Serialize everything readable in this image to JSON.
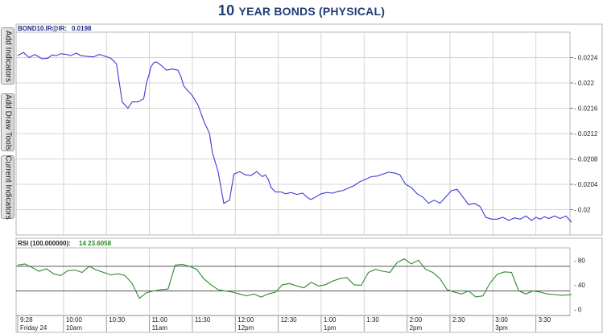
{
  "title": {
    "main": "10",
    "rest": "YEAR BONDS (PHYSICAL)"
  },
  "side_tabs": [
    "Add Indicators",
    "Add Draw Tools",
    "Current Indicators"
  ],
  "price_panel": {
    "symbol_label": "BOND10.IR@IR:",
    "last_value": "0.0198"
  },
  "rsi_panel": {
    "label": "RSI (100.000000):",
    "values": "14 23.6058"
  },
  "colors": {
    "title": "#1f3e78",
    "price_line": "#3b3bd6",
    "rsi_line": "#2a8a2a",
    "grid": "#d4d4d4",
    "band": "#555555",
    "rsi_value": "#1e8a1e",
    "label": "#1a2a8a"
  },
  "chart_data": [
    {
      "type": "line",
      "title": "",
      "ylim": [
        0.0196,
        0.0228
      ],
      "y_ticks": [
        0.02,
        0.0204,
        0.0208,
        0.0212,
        0.0216,
        0.022,
        0.0224
      ],
      "y_tick_labels": [
        "0.02",
        "0.0204",
        "0.0208",
        "0.0212",
        "0.0216",
        "0.022",
        "0.0224"
      ],
      "x_ticks": [
        "9:28",
        "10:00",
        "10:30",
        "11:00",
        "11:30",
        "12:00",
        "12:30",
        "1:00",
        "1:30",
        "2:00",
        "2:30",
        "3:00",
        "3:30"
      ],
      "x_sublabels": [
        "Friday 24",
        "10am",
        "",
        "11am",
        "",
        "12pm",
        "",
        "1pm",
        "",
        "2pm",
        "",
        "3pm",
        ""
      ],
      "x_unit": "minutes after 9:28",
      "series": [
        {
          "x": [
            0,
            4,
            8,
            12,
            14,
            17,
            21,
            24,
            27,
            30,
            34,
            37,
            41,
            44,
            48,
            53,
            57,
            61,
            65,
            69,
            73,
            77,
            80,
            84,
            88,
            90,
            92,
            93,
            95,
            97,
            100,
            104,
            108,
            112,
            114,
            116,
            118,
            122,
            126,
            130,
            134,
            136,
            140,
            144,
            148,
            151,
            155,
            159,
            163,
            167,
            171,
            173,
            175,
            177,
            180,
            184,
            187,
            191,
            195,
            199,
            203,
            205,
            208,
            212,
            216,
            220,
            224,
            227,
            231,
            235,
            239,
            243,
            247,
            251,
            255,
            259,
            263,
            267,
            271,
            275,
            279,
            283,
            287,
            291,
            295,
            299,
            303,
            307,
            311,
            315,
            319,
            323,
            327,
            331,
            335,
            339,
            343,
            347,
            351,
            355,
            359,
            362,
            365,
            368,
            371,
            375,
            379,
            383,
            387
          ],
          "y": [
            0.02243,
            0.02248,
            0.0224,
            0.02245,
            0.02242,
            0.02238,
            0.02239,
            0.02244,
            0.02243,
            0.02246,
            0.02245,
            0.02243,
            0.02247,
            0.02243,
            0.02242,
            0.02241,
            0.02245,
            0.02242,
            0.02239,
            0.0223,
            0.0217,
            0.0216,
            0.0217,
            0.0217,
            0.02175,
            0.022,
            0.02215,
            0.02225,
            0.02232,
            0.02233,
            0.02228,
            0.0222,
            0.02222,
            0.0222,
            0.0221,
            0.02195,
            0.0219,
            0.0218,
            0.02165,
            0.0214,
            0.0212,
            0.0209,
            0.0206,
            0.0201,
            0.02015,
            0.02056,
            0.0206,
            0.02055,
            0.02054,
            0.0206,
            0.02052,
            0.02055,
            0.02048,
            0.02035,
            0.02028,
            0.02028,
            0.02025,
            0.02027,
            0.02024,
            0.02026,
            0.02018,
            0.02016,
            0.0202,
            0.02025,
            0.02027,
            0.02026,
            0.02029,
            0.0203,
            0.02034,
            0.02038,
            0.02044,
            0.02048,
            0.02052,
            0.02053,
            0.02056,
            0.02059,
            0.02058,
            0.02055,
            0.0204,
            0.02035,
            0.02025,
            0.0202,
            0.0201,
            0.02015,
            0.0201,
            0.0202,
            0.0203,
            0.02032,
            0.0202,
            0.02008,
            0.0201,
            0.02005,
            0.01988,
            0.01985,
            0.01985,
            0.01988,
            0.01983,
            0.01987,
            0.01985,
            0.0199,
            0.01983,
            0.01988,
            0.01985,
            0.01989,
            0.01986,
            0.0199,
            0.01986,
            0.0199,
            0.0198
          ]
        }
      ]
    },
    {
      "type": "line",
      "title": "",
      "ylim": [
        -10,
        100
      ],
      "y_ticks": [
        0,
        40,
        80
      ],
      "y_tick_labels": [
        "0",
        "40",
        "80"
      ],
      "bands": [
        30,
        70
      ],
      "x_unit": "minutes after 9:28",
      "series": [
        {
          "x": [
            0,
            5,
            10,
            15,
            20,
            25,
            30,
            35,
            40,
            45,
            50,
            55,
            60,
            65,
            70,
            75,
            80,
            85,
            90,
            95,
            100,
            105,
            110,
            115,
            120,
            125,
            130,
            135,
            140,
            145,
            150,
            155,
            160,
            165,
            170,
            175,
            180,
            185,
            190,
            195,
            200,
            205,
            210,
            215,
            220,
            225,
            230,
            235,
            240,
            245,
            250,
            255,
            260,
            265,
            270,
            275,
            280,
            285,
            290,
            295,
            300,
            305,
            310,
            315,
            320,
            325,
            330,
            335,
            340,
            345,
            350,
            355,
            360,
            365,
            370,
            375,
            380,
            385,
            387
          ],
          "y": [
            72,
            74,
            68,
            62,
            66,
            58,
            55,
            63,
            64,
            60,
            70,
            64,
            60,
            56,
            58,
            55,
            42,
            18,
            27,
            30,
            32,
            33,
            72,
            73,
            70,
            65,
            50,
            40,
            32,
            30,
            28,
            25,
            22,
            25,
            20,
            25,
            28,
            40,
            42,
            38,
            35,
            44,
            38,
            40,
            46,
            50,
            52,
            40,
            39,
            60,
            65,
            62,
            60,
            76,
            82,
            74,
            80,
            65,
            60,
            50,
            32,
            28,
            25,
            30,
            20,
            22,
            43,
            57,
            61,
            60,
            30,
            25,
            30,
            28,
            25,
            24,
            23,
            23.6,
            24
          ]
        }
      ]
    }
  ]
}
